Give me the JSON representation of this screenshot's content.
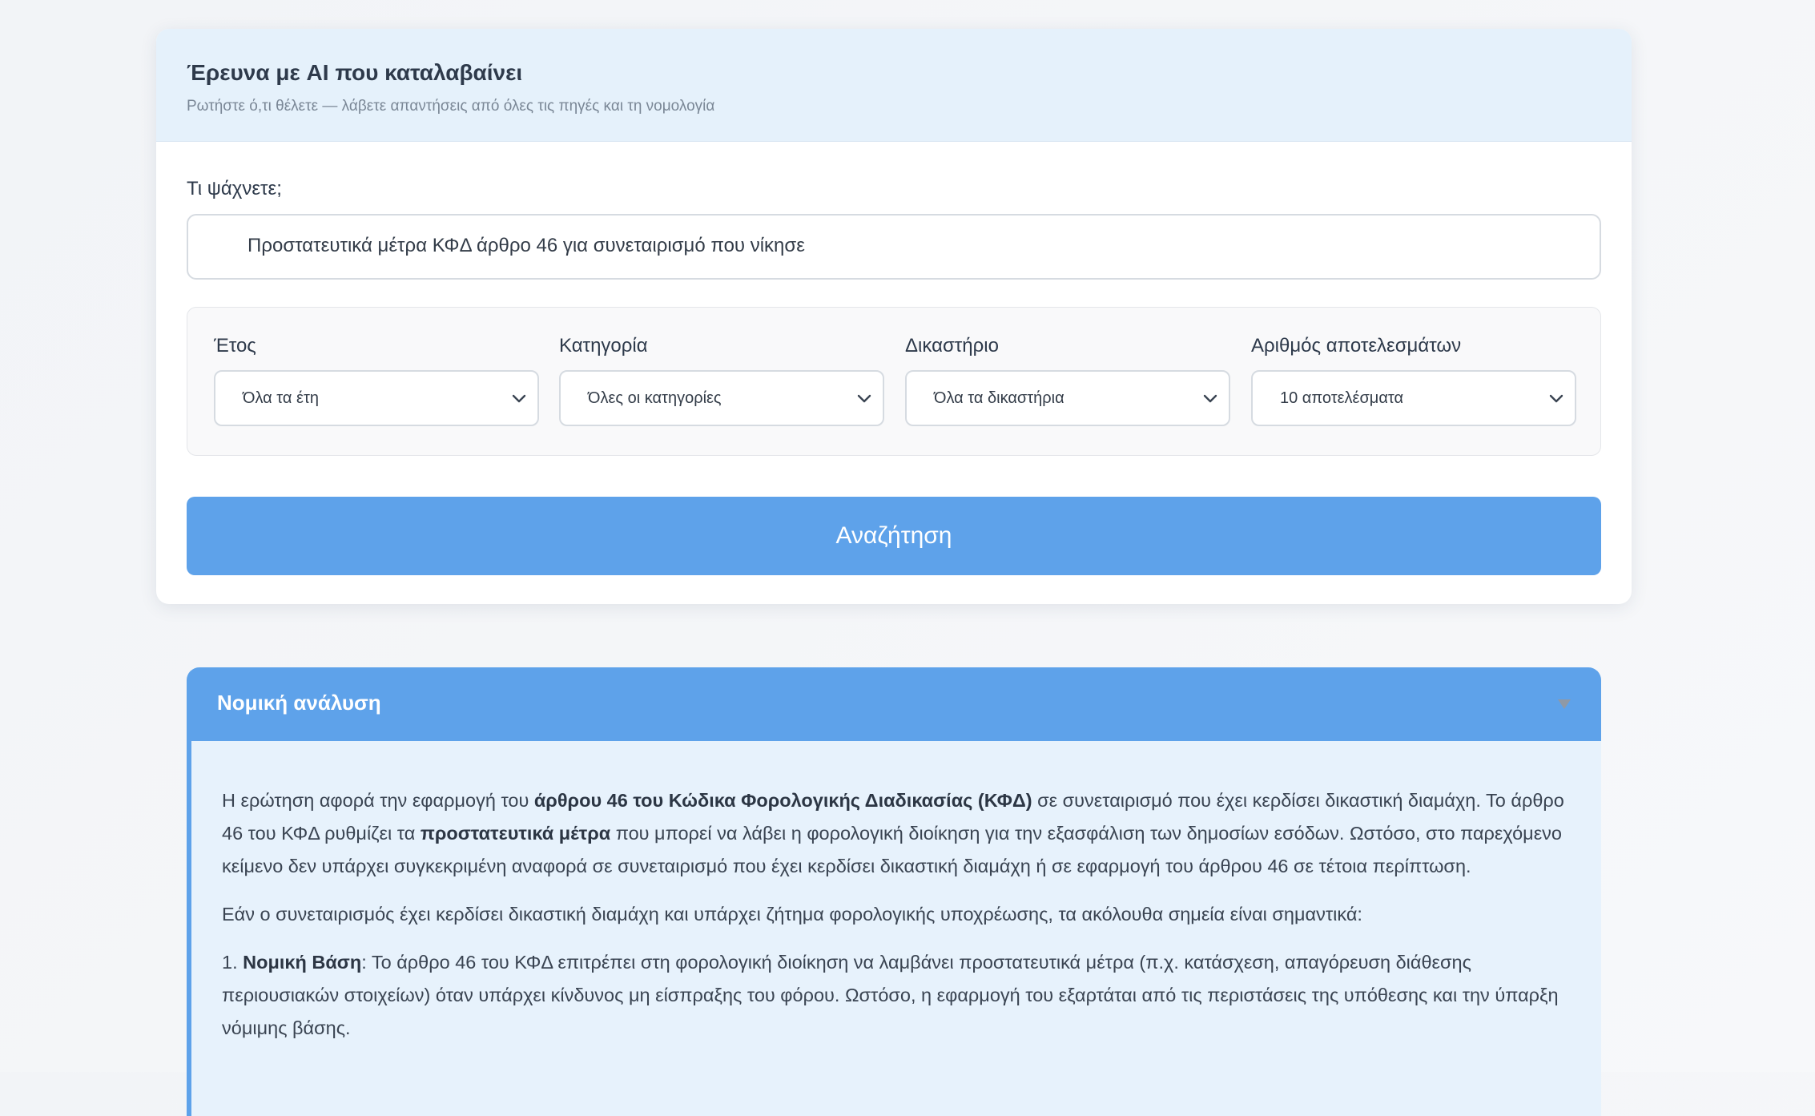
{
  "search_card": {
    "title": "Έρευνα με AI που καταλαβαίνει",
    "subtitle": "Ρωτήστε ό,τι θέλετε — λάβετε απαντήσεις από όλες τις πηγές και τη νομολογία",
    "query_label": "Τι ψάχνετε;",
    "query_value": "Προστατευτικά μέτρα ΚΦΔ άρθρο 46 για συνεταιρισμό που νίκησε"
  },
  "filters": [
    {
      "label": "Έτος",
      "value": "Όλα τα έτη",
      "icon": "chevron-down-icon"
    },
    {
      "label": "Κατηγορία",
      "value": "Όλες οι κατηγορίες",
      "icon": "chevron-down-icon"
    },
    {
      "label": "Δικαστήριο",
      "value": "Όλα τα δικαστήρια",
      "icon": "chevron-down-icon"
    },
    {
      "label": "Αριθμός αποτελεσμάτων",
      "value": "10 αποτελέσματα",
      "icon": "chevron-down-icon"
    }
  ],
  "search_button": {
    "label": "Αναζήτηση"
  },
  "analysis": {
    "title": "Νομική ανάλυση",
    "toggle_icon": "caret-down-icon",
    "p1": {
      "t1": "Η ερώτηση αφορά την εφαρμογή του ",
      "b1": "άρθρου 46 του Κώδικα Φορολογικής Διαδικασίας (ΚΦΔ)",
      "t2": " σε συνεταιρισμό που έχει κερδίσει δικαστική διαμάχη. Το άρθρο 46 του ΚΦΔ ρυθμίζει τα ",
      "b2": "προστατευτικά μέτρα",
      "t3": " που μπορεί να λάβει η φορολογική διοίκηση για την εξασφάλιση των δημοσίων εσόδων. Ωστόσο, στο παρεχόμενο κείμενο δεν υπάρχει συγκεκριμένη αναφορά σε συνεταιρισμό που έχει κερδίσει δικαστική διαμάχη ή σε εφαρμογή του άρθρου 46 σε τέτοια περίπτωση."
    },
    "p2": "Εάν ο συνεταιρισμός έχει κερδίσει δικαστική διαμάχη και υπάρχει ζήτημα φορολογικής υποχρέωσης, τα ακόλουθα σημεία είναι σημαντικά:",
    "p3": {
      "num": "1. ",
      "b1": "Νομική Βάση",
      "t1": ": Το άρθρο 46 του ΚΦΔ επιτρέπει στη φορολογική διοίκηση να λαμβάνει προστατευτικά μέτρα (π.χ. κατάσχεση, απαγόρευση διάθεσης περιουσιακών στοιχείων) όταν υπάρχει κίνδυνος μη είσπραξης του φόρου. Ωστόσο, η εφαρμογή του εξαρτάται από τις περιστάσεις της υπόθεσης και την ύπαρξη νόμιμης βάσης."
    }
  },
  "colors": {
    "accent": "#5ea2ea",
    "header_bg": "#e5f1fb",
    "analysis_bg": "#e7f2fc"
  }
}
